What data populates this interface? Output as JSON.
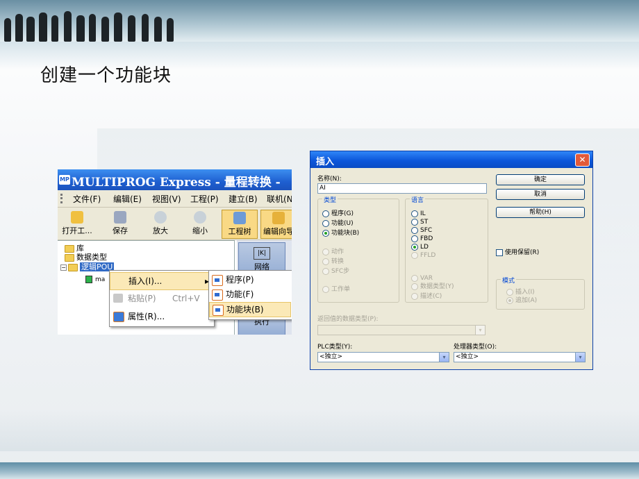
{
  "slide": {
    "title": "创建一个功能块"
  },
  "left_screenshot": {
    "app_icon_text": "MP",
    "window_title": "MULTIPROG Express - 量程转换 -",
    "menu": [
      "文件(F)",
      "编辑(E)",
      "视图(V)",
      "工程(P)",
      "建立(B)",
      "联机(N"
    ],
    "toolbar": [
      "打开工...",
      "保存",
      "放大",
      "缩小",
      "工程树",
      "编辑向导"
    ],
    "tree": {
      "items": [
        "库",
        "数据类型",
        "逻辑POU"
      ],
      "child": "ma"
    },
    "right_pane": {
      "network_label": "网络",
      "network_icon_text": "|K|",
      "exec_label": "执行"
    },
    "context_menu": {
      "items": [
        {
          "label": "插入(I)...",
          "shortcut": ""
        },
        {
          "label": "粘贴(P)",
          "shortcut": "Ctrl+V"
        },
        {
          "label": "属性(R)...",
          "shortcut": ""
        }
      ],
      "submenu_arrow": "▸"
    },
    "submenu": {
      "items": [
        "程序(P)",
        "功能(F)",
        "功能块(B)"
      ]
    }
  },
  "dialog": {
    "title": "插入",
    "close_glyph": "✕",
    "name_label": "名称(N):",
    "name_value": "AI",
    "buttons": {
      "ok": "确定",
      "cancel": "取消",
      "help": "帮助(H)"
    },
    "type_group": {
      "caption": "类型",
      "options": [
        {
          "label": "程序(G)",
          "checked": false,
          "enabled": true
        },
        {
          "label": "功能(U)",
          "checked": false,
          "enabled": true
        },
        {
          "label": "功能块(B)",
          "checked": true,
          "enabled": true
        },
        {
          "label": "动作",
          "checked": false,
          "enabled": false
        },
        {
          "label": "转换",
          "checked": false,
          "enabled": false
        },
        {
          "label": "SFC步",
          "checked": false,
          "enabled": false
        },
        {
          "label": "工作单",
          "checked": false,
          "enabled": false
        }
      ]
    },
    "language_group": {
      "caption": "语言",
      "options": [
        {
          "label": "IL",
          "checked": false,
          "enabled": true
        },
        {
          "label": "ST",
          "checked": false,
          "enabled": true
        },
        {
          "label": "SFC",
          "checked": false,
          "enabled": true
        },
        {
          "label": "FBD",
          "checked": false,
          "enabled": true
        },
        {
          "label": "LD",
          "checked": true,
          "enabled": true
        },
        {
          "label": "FFLD",
          "checked": false,
          "enabled": false
        },
        {
          "label": "VAR",
          "checked": false,
          "enabled": false
        },
        {
          "label": "数据类型(Y)",
          "checked": false,
          "enabled": false
        },
        {
          "label": "描述(C)",
          "checked": false,
          "enabled": false
        }
      ]
    },
    "retain_checkbox": {
      "label": "使用保留(R)",
      "checked": false
    },
    "mode_group": {
      "caption": "模式",
      "options": [
        {
          "label": "插入(I)",
          "checked": false,
          "enabled": false
        },
        {
          "label": "追加(A)",
          "checked": true,
          "enabled": false
        }
      ]
    },
    "return_type_label": "返回值的数据类型(P):",
    "return_type_value": "",
    "plc_type_label": "PLC类型(Y):",
    "plc_type_value": "<独立>",
    "processor_type_label": "处理器类型(O):",
    "processor_type_value": "<独立>",
    "dropdown_glyph": "▾"
  },
  "colors": {
    "xp_title_blue": "#0c57db",
    "close_red": "#e25a3a",
    "group_caption_blue": "#0046d5",
    "dialog_face": "#ece9d8"
  }
}
